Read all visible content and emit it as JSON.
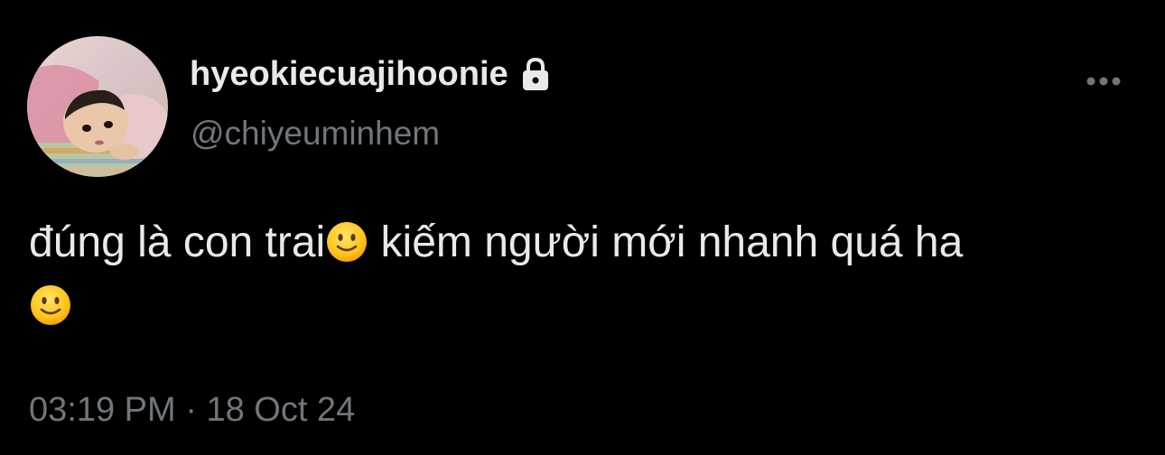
{
  "author": {
    "display_name": "hyeokiecuajihoonie",
    "handle": "@chiyeuminhem",
    "protected_icon": "lock-icon",
    "avatar": "baby-photo-avatar"
  },
  "tweet": {
    "text_part1": "đúng là con trai",
    "text_part2": " kiếm người mới nhanh quá ha",
    "emoji": "slightly-smiling-face"
  },
  "meta": {
    "time": "03:19 PM",
    "separator": "·",
    "date": "18 Oct 24"
  },
  "actions": {
    "more_icon": "more-horizontal-icon"
  },
  "colors": {
    "background": "#000000",
    "primary_text": "#e7e9ea",
    "secondary_text": "#71767b"
  }
}
